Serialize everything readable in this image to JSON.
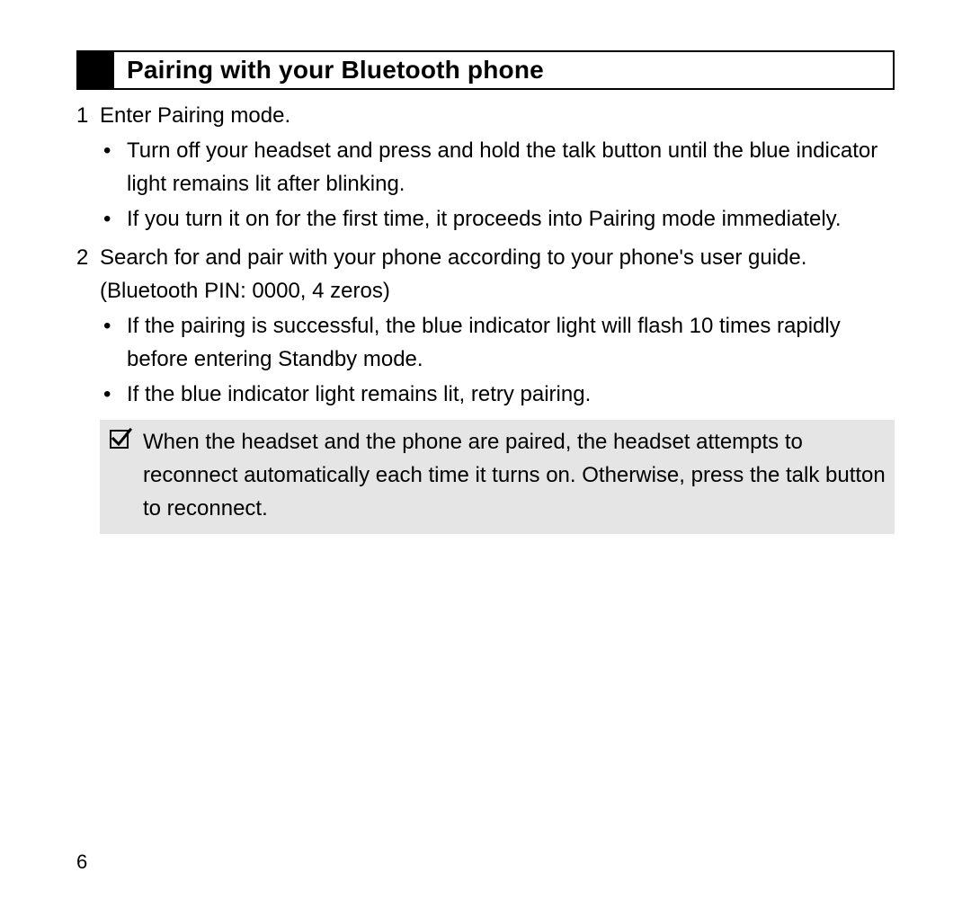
{
  "heading": "Pairing with your Bluetooth phone",
  "steps": [
    {
      "num": "1",
      "text": "Enter Pairing mode.",
      "bullets": [
        "Turn off your headset and press and hold the talk button until the blue indicator light remains lit after blinking.",
        "If you turn it on for the first time, it proceeds into Pairing mode immediately."
      ]
    },
    {
      "num": "2",
      "text": "Search for and pair with your phone according to your phone's user guide. (Bluetooth PIN: 0000, 4 zeros)",
      "bullets": [
        "If the pairing is successful, the blue indicator light will flash 10 times rapidly before entering Standby mode.",
        "If the blue indicator light remains lit, retry pairing."
      ]
    }
  ],
  "note": "When the headset and the phone are paired, the headset attempts to reconnect automatically each time it turns on. Otherwise, press the talk button to reconnect.",
  "page_number": "6"
}
